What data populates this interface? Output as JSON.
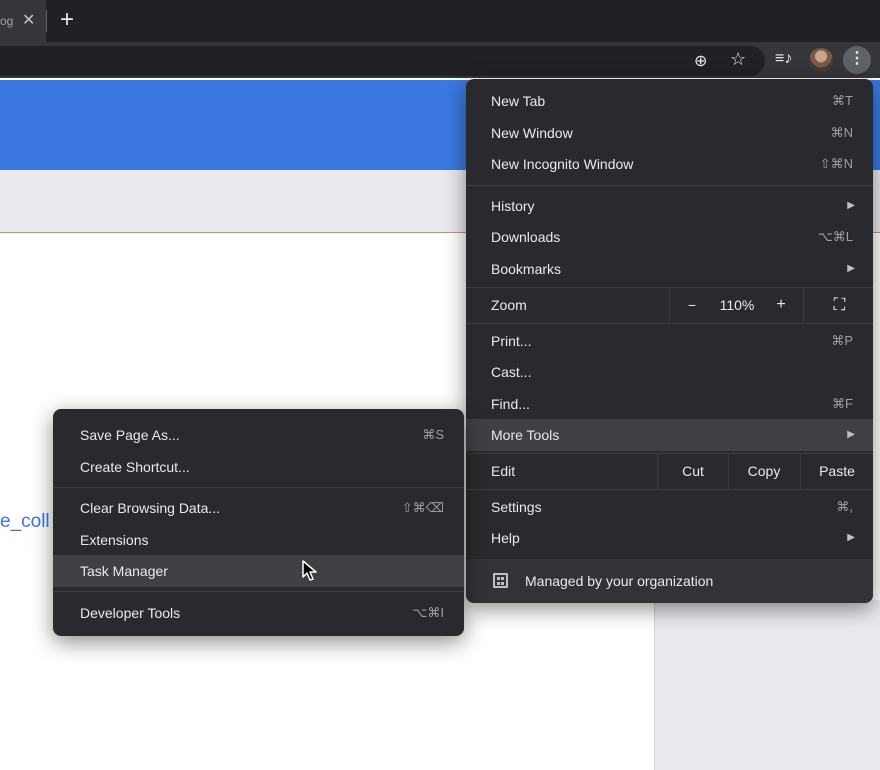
{
  "tabstrip": {
    "tab_title": "og",
    "tab_close_glyph": "✕",
    "new_tab_glyph": "+"
  },
  "toolbar": {
    "zoom_icon": "zoom-icon",
    "zoom_glyph": "⊕",
    "bookmark_icon": "star-icon",
    "bookmark_glyph": "☆",
    "media_icon": "media-control-icon",
    "media_glyph": "≡♪",
    "menu_icon": "kebab-menu-icon",
    "menu_glyph": "⋮"
  },
  "page": {
    "link_text": "e_coll",
    "brand_color": "#3b78e0"
  },
  "main_menu": {
    "new_tab": {
      "label": "New Tab",
      "shortcut": "⌘T"
    },
    "new_window": {
      "label": "New Window",
      "shortcut": "⌘N"
    },
    "new_incognito": {
      "label": "New Incognito Window",
      "shortcut": "⇧⌘N"
    },
    "history": {
      "label": "History",
      "arrow": "▶"
    },
    "downloads": {
      "label": "Downloads",
      "shortcut": "⌥⌘L"
    },
    "bookmarks": {
      "label": "Bookmarks",
      "arrow": "▶"
    },
    "zoom": {
      "label": "Zoom",
      "minus": "−",
      "value": "110%",
      "plus": "+",
      "fullscreen_glyph": "⛶"
    },
    "print": {
      "label": "Print...",
      "shortcut": "⌘P"
    },
    "cast": {
      "label": "Cast..."
    },
    "find": {
      "label": "Find...",
      "shortcut": "⌘F"
    },
    "more_tools": {
      "label": "More Tools",
      "arrow": "▶"
    },
    "edit": {
      "label": "Edit",
      "cut": "Cut",
      "copy": "Copy",
      "paste": "Paste"
    },
    "settings": {
      "label": "Settings",
      "shortcut": "⌘,"
    },
    "help": {
      "label": "Help",
      "arrow": "▶"
    },
    "managed": {
      "label": "Managed by your organization",
      "icon": "building-icon"
    }
  },
  "sub_menu": {
    "save_page": {
      "label": "Save Page As...",
      "shortcut": "⌘S"
    },
    "create_shortcut": {
      "label": "Create Shortcut..."
    },
    "clear_data": {
      "label": "Clear Browsing Data...",
      "shortcut": "⇧⌘⌫"
    },
    "extensions": {
      "label": "Extensions"
    },
    "task_manager": {
      "label": "Task Manager"
    },
    "developer_tools": {
      "label": "Developer Tools",
      "shortcut": "⌥⌘I"
    }
  },
  "colors": {
    "menu_bg": "#292a2d",
    "menu_highlight": "#3f4044",
    "menu_text": "#e8eaed"
  }
}
